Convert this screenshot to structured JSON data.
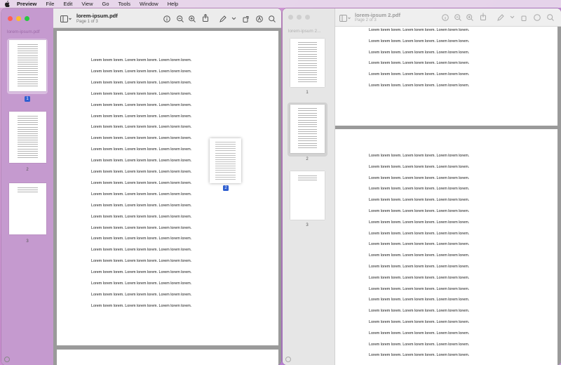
{
  "menu": {
    "app": "Preview",
    "items": [
      "File",
      "Edit",
      "View",
      "Go",
      "Tools",
      "Window",
      "Help"
    ]
  },
  "window1": {
    "title": "lorem-ipsum.pdf",
    "subtitle": "Page 1 of 3",
    "sidebar_title": "lorem-ipsum.pdf",
    "thumb_labels": [
      "1",
      "2",
      "3"
    ],
    "drag_badge": "2"
  },
  "window2": {
    "title": "lorem-ipsum 2.pdf",
    "subtitle": "Page 2 of 3",
    "sidebar_title": "lorem-ipsum 2...",
    "thumb_labels": [
      "1",
      "2",
      "3"
    ]
  },
  "body_text": "Lorem lorem lorem. Lorem lorem lorem. Lorem lorem lorem.",
  "colors": {
    "accent": "#2f5fd0",
    "close": "#ff5f57",
    "minimize": "#febc2e",
    "zoom": "#28c840"
  },
  "icons": [
    "sidebar-icon",
    "info-icon",
    "zoom-out-icon",
    "zoom-in-icon",
    "share-icon",
    "markup-icon",
    "highlight-icon",
    "search-icon"
  ]
}
